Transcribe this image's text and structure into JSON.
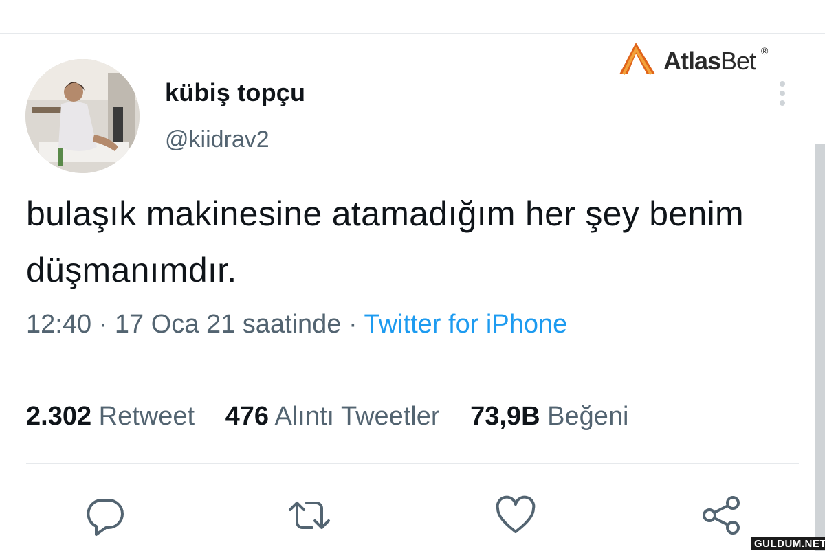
{
  "brand": {
    "name_bold": "Atlas",
    "name_light": "Bet",
    "reg": "®"
  },
  "tweet": {
    "author_name": "kübiş topçu",
    "author_handle": "@kiidrav2",
    "text": "bulaşık makinesine atamadığım her şey benim düşmanımdır.",
    "time": "12:40",
    "date": "17 Oca 21 saatinde",
    "source": "Twitter for iPhone",
    "separator": " · "
  },
  "stats": {
    "retweets_count": "2.302",
    "retweets_label": "Retweet",
    "quotes_count": "476",
    "quotes_label": "Alıntı Tweetler",
    "likes_count": "73,9B",
    "likes_label": "Beğeni"
  },
  "icons": [
    "more-vert-icon",
    "reply-icon",
    "retweet-icon",
    "like-icon",
    "share-icon"
  ],
  "colors": {
    "link": "#1d9bf0",
    "muted": "#536471",
    "text": "#0f1419"
  },
  "watermark": "GULDUM.NET"
}
